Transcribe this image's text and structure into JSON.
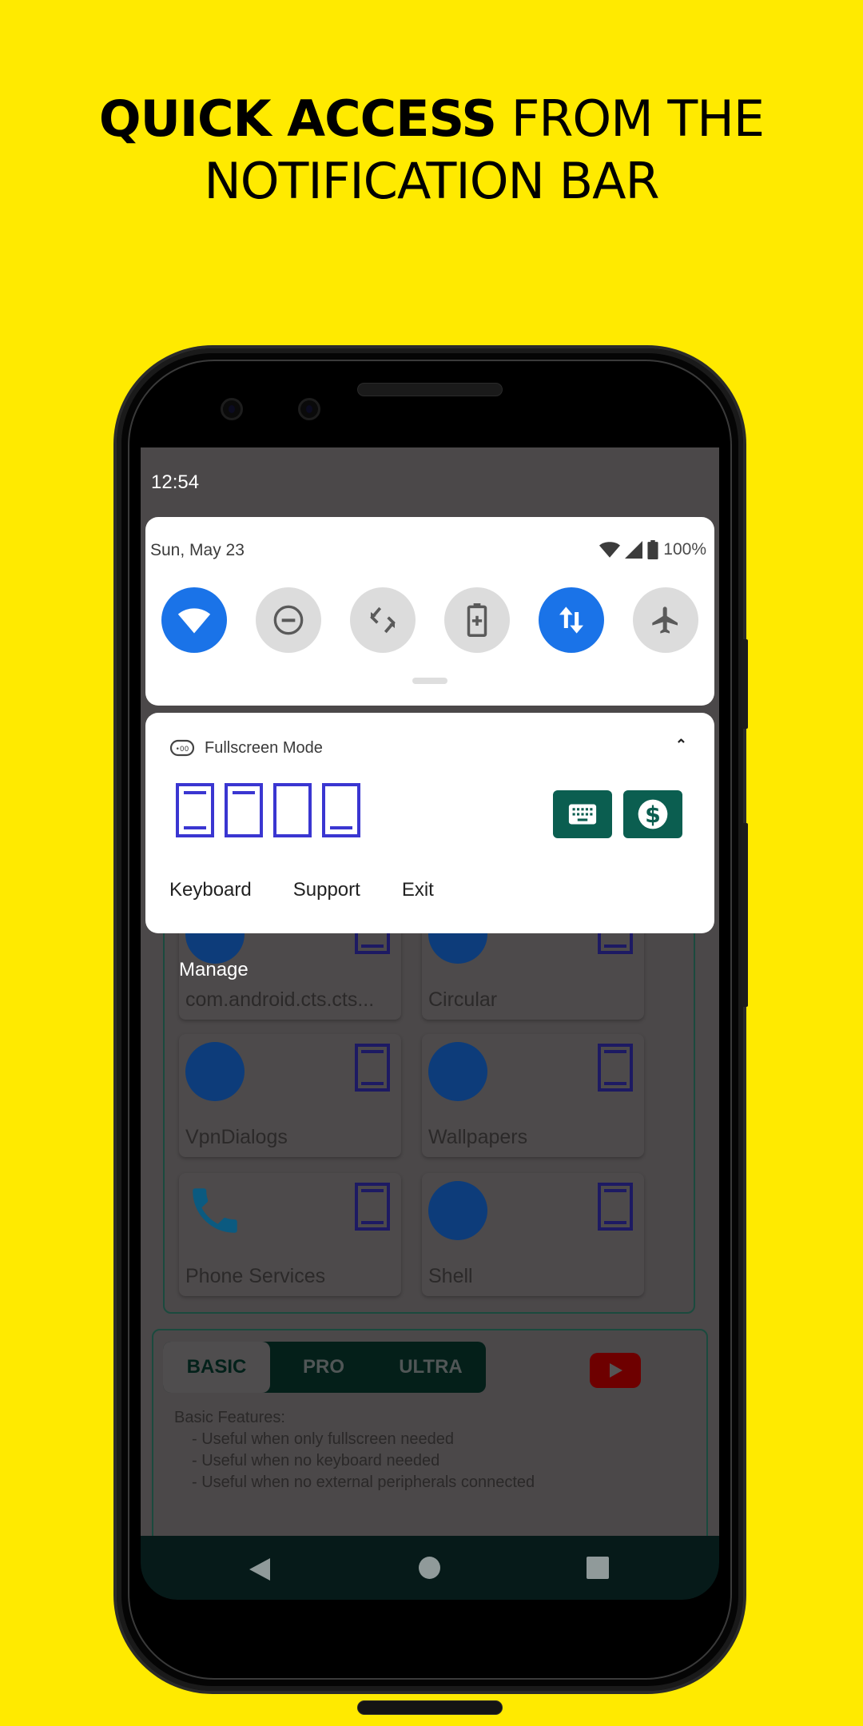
{
  "headline": {
    "bold": "QUICK ACCESS",
    "rest_line1": " FROM THE",
    "line2": "NOTIFICATION BAR"
  },
  "status_bar": {
    "time": "12:54"
  },
  "quick_settings": {
    "date": "Sun, May 23",
    "battery": "100%",
    "tiles": [
      {
        "name": "wifi",
        "icon": "wifi-icon",
        "active": true
      },
      {
        "name": "do-not-disturb",
        "icon": "do-not-disturb-icon",
        "active": false
      },
      {
        "name": "auto-rotate",
        "icon": "auto-rotate-icon",
        "active": false
      },
      {
        "name": "battery-saver",
        "icon": "battery-saver-icon",
        "active": false
      },
      {
        "name": "mobile-data",
        "icon": "mobile-data-icon",
        "active": true
      },
      {
        "name": "airplane-mode",
        "icon": "airplane-icon",
        "active": false
      }
    ]
  },
  "notification": {
    "app_name": "Fullscreen Mode",
    "modes": [
      "top-and-bottom-bars",
      "top-bar-only",
      "no-bars",
      "bottom-bar-only"
    ],
    "buttons": [
      "keyboard-icon",
      "dollar-icon"
    ],
    "actions": [
      "Keyboard",
      "Support",
      "Exit"
    ],
    "manage_label": "Manage"
  },
  "background_app": {
    "apps": [
      {
        "label": "com.android.cts.cts...",
        "icon": "android-icon"
      },
      {
        "label": "Circular",
        "icon": "android-icon"
      },
      {
        "label": "VpnDialogs",
        "icon": "android-icon"
      },
      {
        "label": "Wallpapers",
        "icon": "wallpaper-icon"
      },
      {
        "label": "Phone Services",
        "icon": "phone-icon"
      },
      {
        "label": "Shell",
        "icon": "android-icon"
      }
    ],
    "tiers": [
      "BASIC",
      "PRO",
      "ULTRA"
    ],
    "selected_tier": "BASIC",
    "features_title": "Basic Features:",
    "features": [
      "- Useful when only fullscreen needed",
      "- Useful when no keyboard needed",
      "- Useful when no external peripherals connected"
    ]
  },
  "colors": {
    "background": "#ffea00",
    "active_tile": "#1a73e8",
    "mode_icon": "#3a36d1",
    "notif_button": "#0b5e50"
  }
}
